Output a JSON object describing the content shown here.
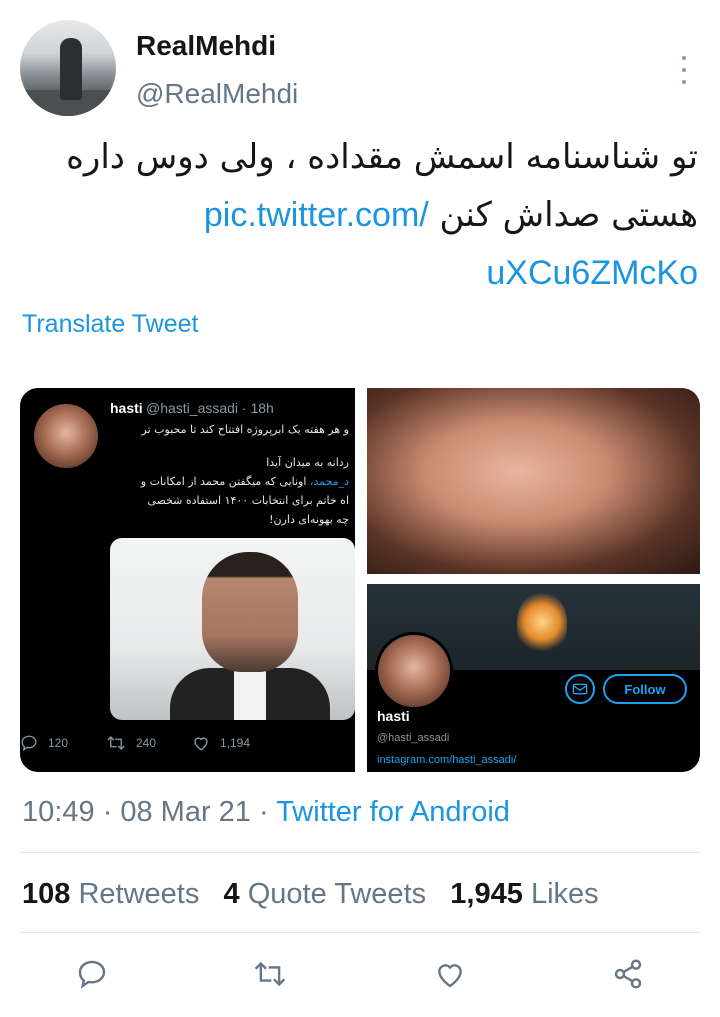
{
  "user": {
    "display_name": "RealMehdi",
    "handle": "@RealMehdi",
    "avatar_icon": "profile-photo"
  },
  "tweet": {
    "text_line1": "تو شناسنامه اسمش مقداده ، ولی دوس داره",
    "text_line2_prefix": "هستی صداش کنن ",
    "link_text_a": "pic.twitter.com/",
    "link_text_b": "uXCu6ZMcKo",
    "translate_label": "Translate Tweet"
  },
  "media": {
    "embedded_tweet": {
      "name": "hasti",
      "handle": "@hasti_assadi · 18h",
      "line1": "و هر هفته یک ابرپروژه افتتاح کند تا محبوب تر",
      "line2": "ردانه به میدان آیدا",
      "line3a": "اونایی که میگفتن محمد از امکانات و",
      "line3b": "د_محمد،",
      "line4": "اه خاتم برای انتخابات ۱۴۰۰ استفاده شخصی",
      "line5": "چه بهونه‌ای دارن!",
      "replies": "120",
      "retweets": "240",
      "likes": "1,194"
    },
    "profile_card": {
      "name": "hasti",
      "handle": "@hasti_assadi",
      "link": "instagram.com/hasti_assadi/",
      "follow_label": "Follow"
    }
  },
  "meta": {
    "time": "10:49",
    "date": "08 Mar 21",
    "source": "Twitter for Android",
    "sep": " · "
  },
  "stats": {
    "retweets_count": "108",
    "retweets_label": "Retweets",
    "quotes_count": "4",
    "quotes_label": "Quote Tweets",
    "likes_count": "1,945",
    "likes_label": "Likes"
  },
  "colors": {
    "accent": "#1b95e0",
    "muted": "#657786",
    "text": "#14171a",
    "divider": "#e1e8ed"
  }
}
